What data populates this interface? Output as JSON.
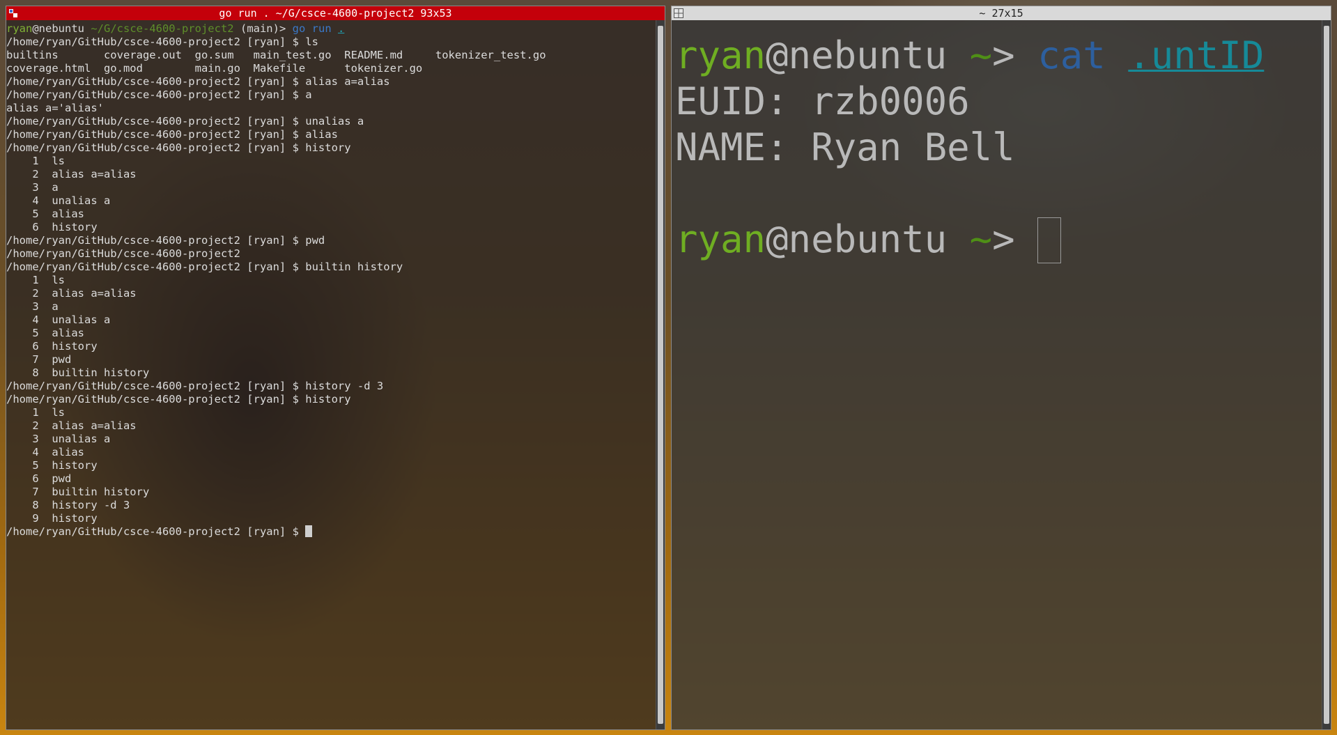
{
  "left_window": {
    "title": "go run . ~/G/csce-4600-project2 93x53",
    "prompt_user": "ryan",
    "prompt_host": "@nebuntu",
    "prompt_path": "~/G/csce-4600-project2",
    "prompt_branch": "(main)>",
    "first_cmd_go": "go run",
    "first_cmd_arg": ".",
    "lines": [
      "/home/ryan/GitHub/csce-4600-project2 [ryan] $ ls",
      "builtins       coverage.out  go.sum   main_test.go  README.md     tokenizer_test.go",
      "coverage.html  go.mod        main.go  Makefile      tokenizer.go",
      "/home/ryan/GitHub/csce-4600-project2 [ryan] $ alias a=alias",
      "/home/ryan/GitHub/csce-4600-project2 [ryan] $ a",
      "alias a='alias'",
      "/home/ryan/GitHub/csce-4600-project2 [ryan] $ unalias a",
      "/home/ryan/GitHub/csce-4600-project2 [ryan] $ alias",
      "/home/ryan/GitHub/csce-4600-project2 [ryan] $ history",
      "    1  ls",
      "    2  alias a=alias",
      "    3  a",
      "    4  unalias a",
      "    5  alias",
      "    6  history",
      "/home/ryan/GitHub/csce-4600-project2 [ryan] $ pwd",
      "/home/ryan/GitHub/csce-4600-project2",
      "/home/ryan/GitHub/csce-4600-project2 [ryan] $ builtin history",
      "    1  ls",
      "    2  alias a=alias",
      "    3  a",
      "    4  unalias a",
      "    5  alias",
      "    6  history",
      "    7  pwd",
      "    8  builtin history",
      "/home/ryan/GitHub/csce-4600-project2 [ryan] $ history -d 3",
      "/home/ryan/GitHub/csce-4600-project2 [ryan] $ history",
      "    1  ls",
      "    2  alias a=alias",
      "    3  unalias a",
      "    4  alias",
      "    5  history",
      "    6  pwd",
      "    7  builtin history",
      "    8  history -d 3",
      "    9  history"
    ],
    "final_prompt": "/home/ryan/GitHub/csce-4600-project2 [ryan] $ "
  },
  "right_window": {
    "title": "~ 27x15",
    "prompt_user": "ryan",
    "prompt_host": "@nebuntu",
    "prompt_tilde": "~",
    "prompt_arrow": ">",
    "cmd": "cat",
    "cmd_arg": ".untID",
    "output_euid": "EUID: rzb0006",
    "output_name": "NAME: Ryan Bell"
  },
  "colors": {
    "active_titlebar": "#c4000a",
    "prompt_green": "#7fb135",
    "command_blue": "#3a78c8",
    "path_cyan": "#1fa3b5"
  }
}
